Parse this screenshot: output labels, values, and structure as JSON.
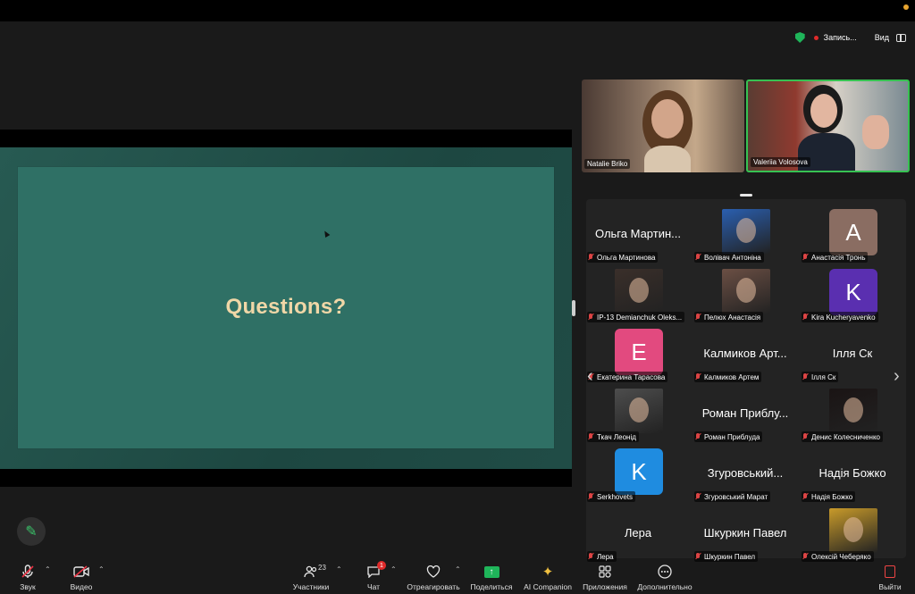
{
  "meeting": {
    "recording_label": "Запись...",
    "view_label": "Вид"
  },
  "shared_screen": {
    "slide_title": "Questions?"
  },
  "video_tiles": [
    {
      "name": "Natalie Briko"
    },
    {
      "name": "Valeriia Volosova"
    }
  ],
  "participants": [
    {
      "display": "Ольга Мартин...",
      "name": "Ольга Мартинова",
      "kind": "text"
    },
    {
      "display": "",
      "name": "Волівач Антоніна",
      "kind": "photo",
      "color": "#2a5fb0"
    },
    {
      "display": "A",
      "name": "Анастасія Тронь",
      "kind": "avatar",
      "color": "#8a6d62"
    },
    {
      "display": "",
      "name": "IP-13 Demianchuk Oleks...",
      "kind": "photo",
      "color": "#3a2f2a"
    },
    {
      "display": "",
      "name": "Пелюх Анастасія",
      "kind": "photo",
      "color": "#6b4f44"
    },
    {
      "display": "K",
      "name": "Kira Kucheryavenko",
      "kind": "avatar",
      "color": "#5a2fb0"
    },
    {
      "display": "E",
      "name": "Екатерина Тарасова",
      "kind": "avatar",
      "color": "#e24a7f"
    },
    {
      "display": "Калмиков Арт...",
      "name": "Калмиков Артем",
      "kind": "text"
    },
    {
      "display": "Ілля Ск",
      "name": "Ілля Ск",
      "kind": "text"
    },
    {
      "display": "",
      "name": "Ткач Леонід",
      "kind": "photo",
      "color": "#4d4d4d"
    },
    {
      "display": "Роман Приблу...",
      "name": "Роман Приблуда",
      "kind": "text"
    },
    {
      "display": "",
      "name": "Денис Колесниченко",
      "kind": "photo",
      "color": "#1a1414"
    },
    {
      "display": "K",
      "name": "Serkhovets",
      "kind": "avatar",
      "color": "#1f8ce0"
    },
    {
      "display": "Згуровський...",
      "name": "Згуровський Марат",
      "kind": "text"
    },
    {
      "display": "Надія Божко",
      "name": "Надія Божко",
      "kind": "text"
    },
    {
      "display": "Лера",
      "name": "Лера",
      "kind": "text"
    },
    {
      "display": "Шкуркин Павел",
      "name": "Шкуркин Павел",
      "kind": "text"
    },
    {
      "display": "",
      "name": "Олексій Чеберяко",
      "kind": "photo",
      "color": "#c89a2a"
    }
  ],
  "toolbar": {
    "audio": "Звук",
    "video": "Видео",
    "participants": "Участники",
    "participants_count": "23",
    "chat": "Чат",
    "chat_badge": "1",
    "react": "Отреагировать",
    "share": "Поделиться",
    "ai": "AI Companion",
    "apps": "Приложения",
    "more": "Дополнительно",
    "leave": "Выйти"
  },
  "colors": {
    "accent_green": "#1fb55a",
    "slide_bg": "#2f7065",
    "slide_title": "#f0d7a7",
    "speaker_border": "#37c252"
  }
}
